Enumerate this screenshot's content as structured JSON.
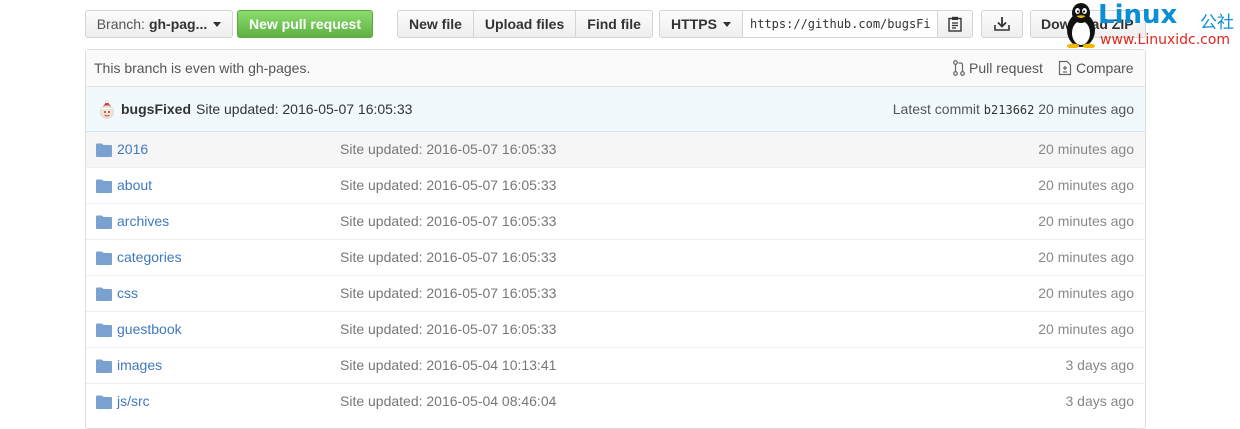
{
  "toolbar": {
    "branch_prefix": "Branch:",
    "branch_name": "gh-pag...",
    "new_pull_request": "New pull request",
    "new_file": "New file",
    "upload_files": "Upload files",
    "find_file": "Find file",
    "clone_protocol": "HTTPS",
    "clone_url": "https://github.com/bugsFi",
    "download_zip": "Download ZIP"
  },
  "watermark": {
    "brand": "Linux",
    "brand_cjk": "公社",
    "url": "www.Linuxidc.com"
  },
  "branch_info": {
    "status": "This branch is even with gh-pages.",
    "pull_request": "Pull request",
    "compare": "Compare"
  },
  "commit": {
    "author": "bugsFixed",
    "message": "Site updated: 2016-05-07 16:05:33",
    "latest_label": "Latest commit",
    "sha": "b213662",
    "age": "20 minutes ago"
  },
  "files": [
    {
      "name": "2016",
      "message": "Site updated: 2016-05-07 16:05:33",
      "age": "20 minutes ago"
    },
    {
      "name": "about",
      "message": "Site updated: 2016-05-07 16:05:33",
      "age": "20 minutes ago"
    },
    {
      "name": "archives",
      "message": "Site updated: 2016-05-07 16:05:33",
      "age": "20 minutes ago"
    },
    {
      "name": "categories",
      "message": "Site updated: 2016-05-07 16:05:33",
      "age": "20 minutes ago"
    },
    {
      "name": "css",
      "message": "Site updated: 2016-05-07 16:05:33",
      "age": "20 minutes ago"
    },
    {
      "name": "guestbook",
      "message": "Site updated: 2016-05-07 16:05:33",
      "age": "20 minutes ago"
    },
    {
      "name": "images",
      "message": "Site updated: 2016-05-04 10:13:41",
      "age": "3 days ago"
    },
    {
      "name": "js",
      "name_sub": "src",
      "message": "Site updated: 2016-05-04 08:46:04",
      "age": "3 days ago"
    }
  ],
  "colors": {
    "link": "#4078c0",
    "green_button": "#60b044",
    "commit_bar": "#f2f9fc",
    "watermark_blue": "#0a8fd6",
    "watermark_red": "#e1261c"
  },
  "icons": [
    "caret-down-icon",
    "clipboard-icon",
    "download-icon",
    "pull-request-icon",
    "compare-icon",
    "folder-icon",
    "avatar",
    "penguin-logo"
  ]
}
